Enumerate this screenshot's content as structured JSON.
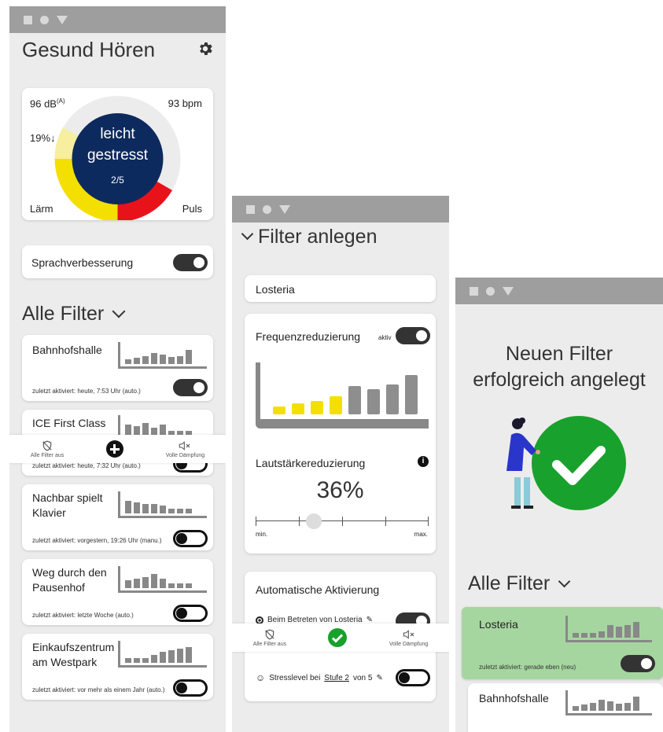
{
  "screen1": {
    "title": "Gesund Hören",
    "gauge": {
      "db_value": "96 dB",
      "db_unit": "(A)",
      "bpm": "93 bpm",
      "percent": "19%↓",
      "state_line1": "leicht",
      "state_line2": "gestresst",
      "level": "2/5",
      "left_label": "Lärm",
      "right_label": "Puls"
    },
    "speech": {
      "label": "Sprachverbesserung",
      "on": true
    },
    "all_filters_title": "Alle Filter",
    "filters": [
      {
        "name1": "Bahnhofshalle",
        "name2": "",
        "meta": "zuletzt aktiviert: heute, 7:53 Uhr (auto.)",
        "on": true
      },
      {
        "name1": "ICE First Class",
        "name2": "",
        "meta": "zuletzt aktiviert: heute, 7:32 Uhr (auto.)",
        "on": false
      },
      {
        "name1": "Nachbar spielt",
        "name2": "Klavier",
        "meta": "zuletzt aktiviert: vorgestern, 19:26 Uhr (manu.)",
        "on": false
      },
      {
        "name1": "Weg durch den",
        "name2": "Pausenhof",
        "meta": "zuletzt aktiviert: letzte Woche (auto.)",
        "on": false
      },
      {
        "name1": "Einkaufszentrum",
        "name2": "am Westpark",
        "meta": "zuletzt aktiviert: vor mehr als einem Jahr (auto.)",
        "on": false
      }
    ],
    "nav": {
      "left": "Alle Filter aus",
      "right": "Volle Dämpfung"
    }
  },
  "screen2": {
    "title": "Filter anlegen",
    "name_value": "Losteria",
    "freq_label": "Frequenzreduzierung",
    "freq_active": "aktiv",
    "vol_label": "Lautstärkereduzierung",
    "vol_value": "36%",
    "slider_min": "min.",
    "slider_max": "max.",
    "auto_title": "Automatische Aktivierung",
    "rule1": "Beim Betreten von Losteria",
    "rule2_prefix": "Stresslevel bei",
    "rule2_link": "Stufe 2",
    "rule2_suffix": "von 5",
    "nav": {
      "left": "Alle Filter aus",
      "right": "Volle Dämpfung"
    }
  },
  "screen3": {
    "success_line1": "Neuen Filter",
    "success_line2": "erfolgreich angelegt",
    "all_filters_title": "Alle Filter",
    "filters": [
      {
        "name": "Losteria",
        "meta": "zuletzt aktiviert: gerade eben (neu)",
        "on": true
      },
      {
        "name": "Bahnhofshalle"
      }
    ]
  },
  "colors": {
    "navy": "#0d2a5e",
    "yellow": "#f4e000",
    "red": "#e8131a",
    "green": "#18a12c",
    "gray": "#8e8e8e",
    "success_card": "#a6d6a0"
  }
}
